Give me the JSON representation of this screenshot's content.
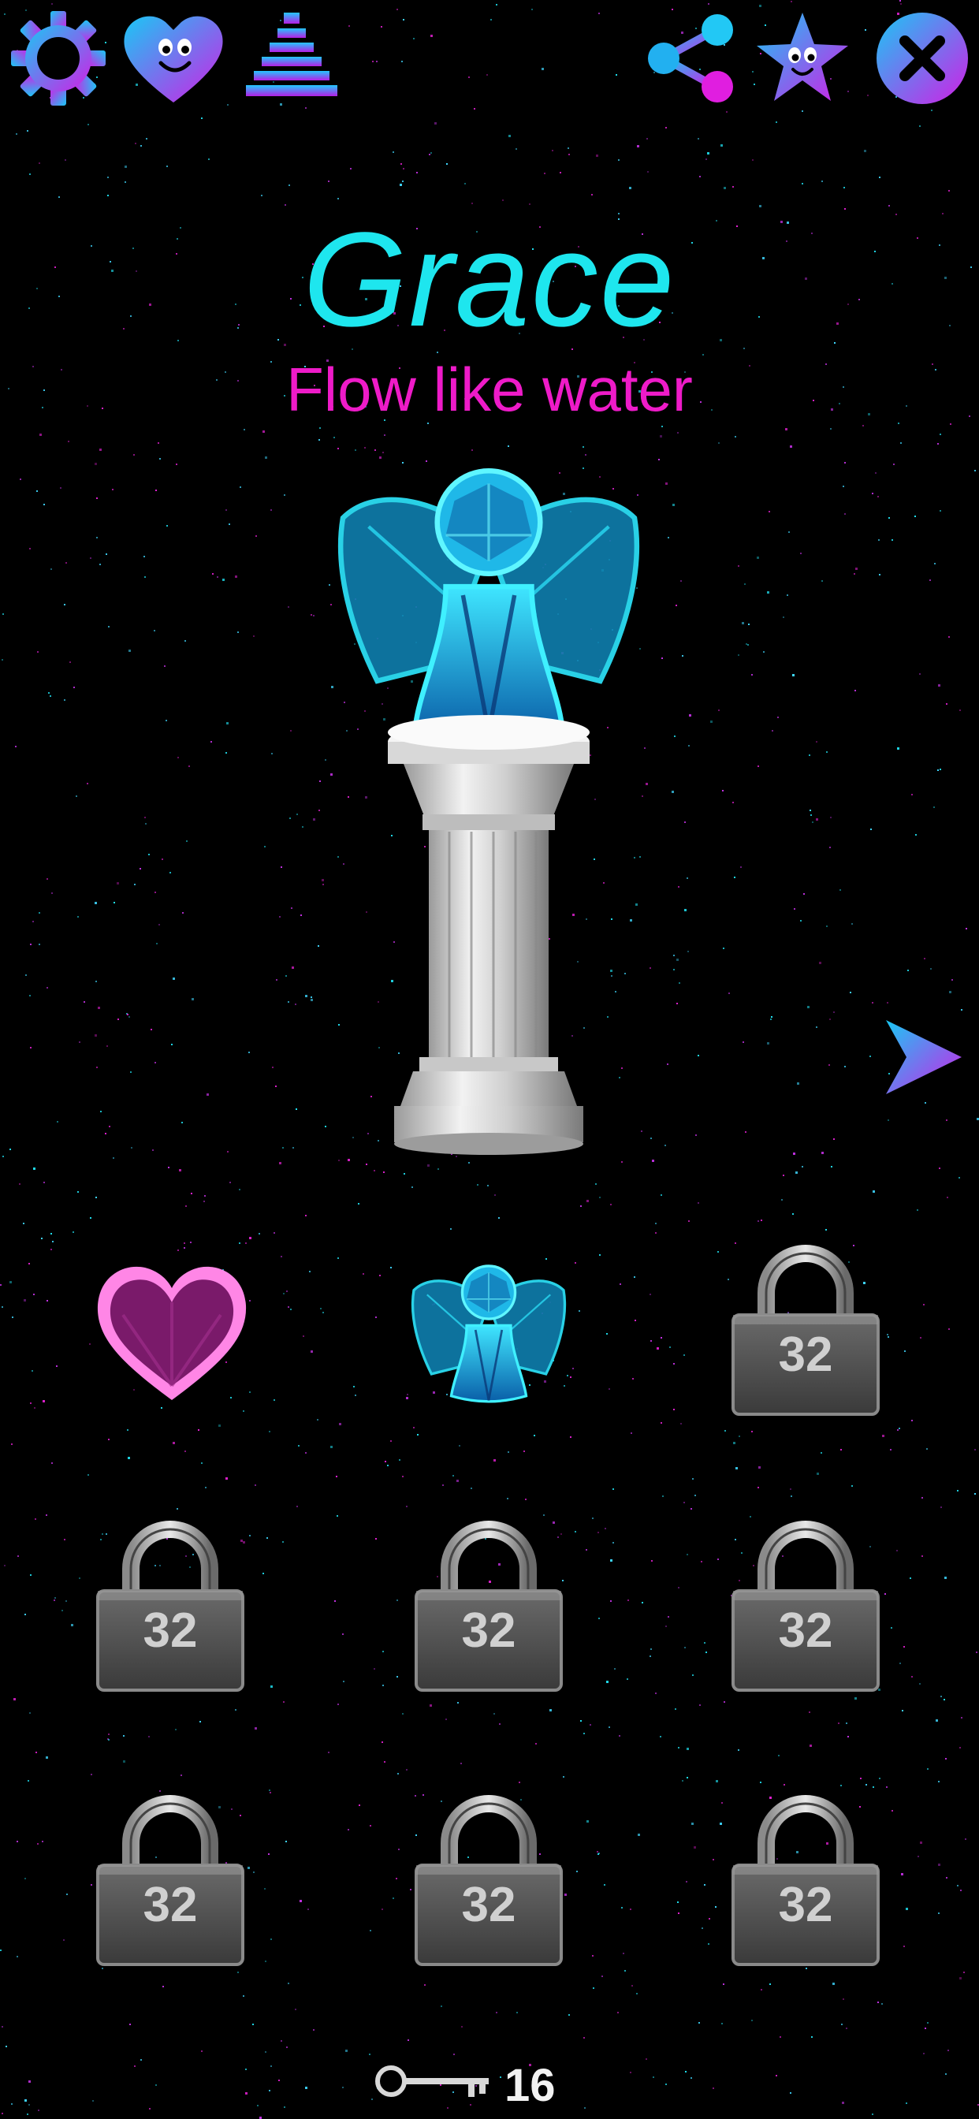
{
  "header": {
    "icons": [
      "gear-icon",
      "heart-face-icon",
      "pyramid-levels-icon",
      "share-icon",
      "star-face-icon",
      "close-icon"
    ]
  },
  "character": {
    "name": "Grace",
    "tagline": "Flow like water"
  },
  "colors": {
    "cyan": "#1ee6ee",
    "magenta": "#ee1bc8",
    "background": "#000000"
  },
  "collection": {
    "row1": [
      {
        "kind": "heart"
      },
      {
        "kind": "angel"
      },
      {
        "kind": "lock",
        "cost": "32"
      }
    ],
    "row2": [
      {
        "kind": "lock",
        "cost": "32"
      },
      {
        "kind": "lock",
        "cost": "32"
      },
      {
        "kind": "lock",
        "cost": "32"
      }
    ],
    "row3": [
      {
        "kind": "lock",
        "cost": "32"
      },
      {
        "kind": "lock",
        "cost": "32"
      },
      {
        "kind": "lock",
        "cost": "32"
      }
    ]
  },
  "footer": {
    "key_count": "16"
  }
}
